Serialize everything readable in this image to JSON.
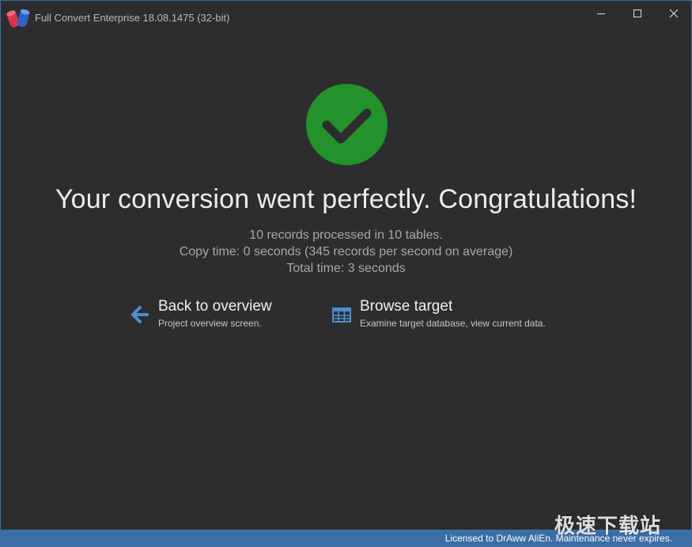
{
  "window": {
    "title": "Full Convert Enterprise 18.08.1475 (32-bit)",
    "controls": {
      "minimize_icon": "minimize-icon",
      "maximize_icon": "maximize-icon",
      "close_icon": "close-icon"
    }
  },
  "result": {
    "status_icon": "checkmark-circle-icon",
    "status_color": "#23922a",
    "headline": "Your conversion went perfectly. Congratulations!",
    "stats": [
      "10 records processed in 10 tables.",
      "Copy time: 0 seconds (345 records per second on average)",
      "Total time: 3 seconds"
    ]
  },
  "actions": {
    "back": {
      "icon": "arrow-left-icon",
      "title": "Back to overview",
      "description": "Project overview screen."
    },
    "browse": {
      "icon": "table-grid-icon",
      "title": "Browse target",
      "description": "Examine target database, view current data."
    },
    "icon_color": "#4a8fd0"
  },
  "statusbar": {
    "license": "Licensed to DrAww AliEn. Maintenance never expires.",
    "background": "#3a6ea5"
  },
  "watermark": {
    "text": "极速下载站"
  }
}
